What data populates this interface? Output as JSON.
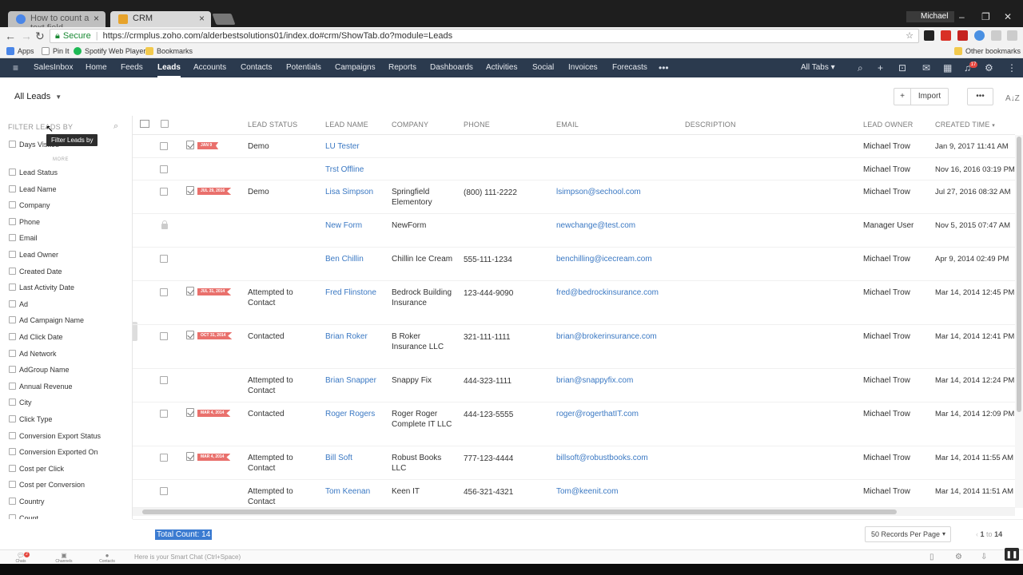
{
  "browser": {
    "tabs": [
      {
        "title": "How to count a text field",
        "active": false
      },
      {
        "title": "CRM",
        "active": true
      }
    ],
    "profile": "Michael",
    "secure_label": "Secure",
    "url": "https://crmplus.zoho.com/alderbestsolutions01/index.do#crm/ShowTab.do?module=Leads",
    "bookmarks": [
      "Apps",
      "Pin It",
      "Spotify Web Player",
      "Bookmarks"
    ],
    "other_bookmarks": "Other bookmarks"
  },
  "nav": {
    "items": [
      "SalesInbox",
      "Home",
      "Feeds",
      "Leads",
      "Accounts",
      "Contacts",
      "Potentials",
      "Campaigns",
      "Reports",
      "Dashboards",
      "Activities",
      "Social",
      "Invoices",
      "Forecasts"
    ],
    "active": "Leads",
    "all_tabs": "All Tabs",
    "notification_count": "17"
  },
  "toolbar": {
    "view": "All Leads",
    "import_label": "Import"
  },
  "sidebar": {
    "header": "FILTER LEADS BY",
    "tooltip": "Filter Leads by",
    "top_item": "Days Visited",
    "more_label": "MORE",
    "filters": [
      "Lead Status",
      "Lead Name",
      "Company",
      "Phone",
      "Email",
      "Lead Owner",
      "Created Date",
      "Last Activity Date",
      "Ad",
      "Ad Campaign Name",
      "Ad Click Date",
      "Ad Network",
      "AdGroup Name",
      "Annual Revenue",
      "City",
      "Click Type",
      "Conversion Export Status",
      "Conversion Exported On",
      "Cost per Click",
      "Cost per Conversion",
      "Country",
      "Count"
    ]
  },
  "table": {
    "columns": [
      "LEAD STATUS",
      "LEAD NAME",
      "COMPANY",
      "PHONE",
      "EMAIL",
      "DESCRIPTION",
      "LEAD OWNER",
      "CREATED TIME"
    ],
    "rows": [
      {
        "flag": "JAN 9",
        "status": "Demo",
        "name": "LU Tester",
        "company": "",
        "phone": "",
        "email": "",
        "owner": "Michael Trow",
        "created": "Jan 9, 2017 11:41 AM"
      },
      {
        "flag": "",
        "status": "",
        "name": "Trst Offline",
        "company": "",
        "phone": "",
        "email": "",
        "owner": "Michael Trow",
        "created": "Nov 16, 2016 03:19 PM"
      },
      {
        "flag": "JUL 29, 2016",
        "status": "Demo",
        "name": "Lisa Simpson",
        "company": "Springfield Elementory",
        "phone": "(800) 111-2222",
        "email": "lsimpson@sechool.com",
        "owner": "Michael Trow",
        "created": "Jul 27, 2016 08:32 AM"
      },
      {
        "flag": "",
        "status": "",
        "name": "New Form",
        "company": "NewForm",
        "phone": "",
        "email": "newchange@test.com",
        "owner": "Manager User",
        "created": "Nov 5, 2015 07:47 AM"
      },
      {
        "flag": "",
        "status": "",
        "name": "Ben Chillin",
        "company": "Chillin Ice Cream",
        "phone": "555-111-1234",
        "email": "benchilling@icecream.com",
        "owner": "Michael Trow",
        "created": "Apr 9, 2014 02:49 PM"
      },
      {
        "flag": "JUL 31, 2014",
        "status": "Attempted to Contact",
        "name": "Fred Flinstone",
        "company": "Bedrock Building Insurance",
        "phone": "123-444-9090",
        "email": "fred@bedrockinsurance.com",
        "owner": "Michael Trow",
        "created": "Mar 14, 2014 12:45 PM"
      },
      {
        "flag": "OCT 31, 2014",
        "status": "Contacted",
        "name": "Brian Roker",
        "company": "B Roker Insurance LLC",
        "phone": "321-111-1111",
        "email": "brian@brokerinsurance.com",
        "owner": "Michael Trow",
        "created": "Mar 14, 2014 12:41 PM"
      },
      {
        "flag": "",
        "status": "Attempted to Contact",
        "name": "Brian Snapper",
        "company": "Snappy Fix",
        "phone": "444-323-1111",
        "email": "brian@snappyfix.com",
        "owner": "Michael Trow",
        "created": "Mar 14, 2014 12:24 PM"
      },
      {
        "flag": "MAR 4, 2014",
        "status": "Contacted",
        "name": "Roger Rogers",
        "company": "Roger Roger Complete IT LLC",
        "phone": "444-123-5555",
        "email": "roger@rogerthatIT.com",
        "owner": "Michael Trow",
        "created": "Mar 14, 2014 12:09 PM"
      },
      {
        "flag": "MAR 4, 2014",
        "status": "Attempted to Contact",
        "name": "Bill Soft",
        "company": "Robust Books LLC",
        "phone": "777-123-4444",
        "email": "billsoft@robustbooks.com",
        "owner": "Michael Trow",
        "created": "Mar 14, 2014 11:55 AM"
      },
      {
        "flag": "",
        "status": "Attempted to Contact",
        "name": "Tom Keenan",
        "company": "Keen IT",
        "phone": "456-321-4321",
        "email": "Tom@keenit.com",
        "owner": "Michael Trow",
        "created": "Mar 14, 2014 11:51 AM"
      }
    ]
  },
  "footer": {
    "total": "Total Count: 14",
    "per_page": "50 Records Per Page",
    "page_from": "1",
    "page_to_label": "to",
    "page_to": "14"
  },
  "bottom": {
    "items": [
      "Chats",
      "Channels",
      "Contacts"
    ],
    "chat_badge": "2",
    "smart_chat": "Here is your Smart Chat (Ctrl+Space)"
  },
  "colors": {
    "nav_bg": "#2b3a4e",
    "link": "#3a78c3",
    "flag": "#e9706c",
    "selection": "#3b7bd1"
  }
}
